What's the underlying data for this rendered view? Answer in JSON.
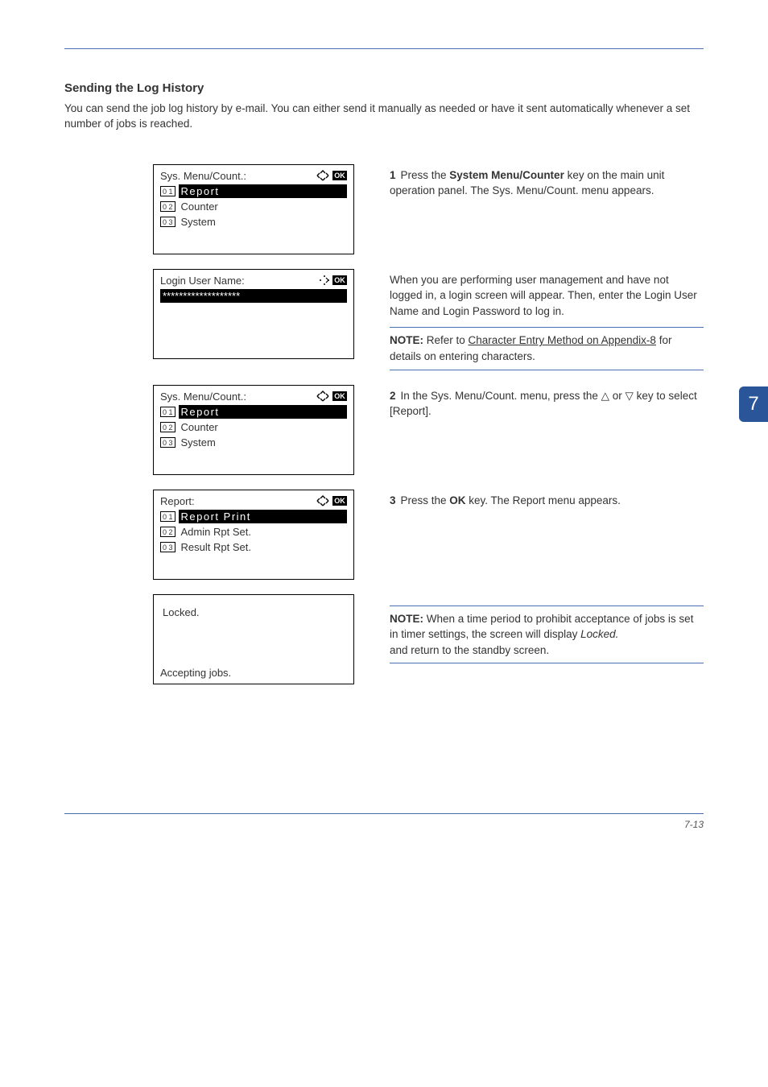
{
  "section_title": "Sending the Log History",
  "intro": "You can send the job log history by e-mail. You can either send it manually as needed or have it sent automatically whenever a set number of jobs is reached.",
  "tab": "7",
  "footer": "7-13",
  "panels": {
    "p1": {
      "title": "Sys. Menu/Count.:",
      "num1": "0 1",
      "line1": "Report",
      "num2": "0 2",
      "line2": "Counter",
      "num3": "0 3",
      "line3": "System"
    },
    "p2": {
      "title": "Login User Name:",
      "line1": "*******************"
    },
    "p3": {
      "title": "Sys. Menu/Count.:",
      "num1": "0 1",
      "line1": "Report",
      "num2": "0 2",
      "line2": "Counter",
      "num3": "0 3",
      "line3": "System"
    },
    "p4": {
      "title": "Report:",
      "num1": "0 1",
      "line1": "Report Print",
      "num2": "0 2",
      "line2": "Admin Rpt Set.",
      "num3": "0 3",
      "line3": "Result Rpt Set."
    },
    "p5": {
      "line1": "Locked.",
      "bottom": "Accepting jobs."
    }
  },
  "steps": {
    "s1": {
      "num": "1",
      "t1": "Press the ",
      "key": "System Menu/Counter",
      "t2": " key on the main unit operation panel. The Sys. Menu/Count. menu appears."
    },
    "s2a": "When you are performing user management and have not logged in, a login screen will appear. Then, enter the Login User Name and Login Password to log in.",
    "s2note": {
      "label": "NOTE:",
      "t1": "Refer to ",
      "link": "Character Entry Method on Appendix-8",
      "t2": " for details on entering characters."
    },
    "s3": {
      "num": "2",
      "text": "In the Sys. Menu/Count. menu, press the △ or ▽ key to select [Report]."
    },
    "s4": {
      "num": "3",
      "t1": "Press the ",
      "key": "OK",
      "t2": " key. The Report menu appears."
    },
    "s5note": {
      "label": "NOTE:",
      "t1": "When a time period to prohibit acceptance of jobs is set in timer settings, the screen will display ",
      "italic": "Locked.",
      "t2": "and return to the standby screen."
    }
  }
}
